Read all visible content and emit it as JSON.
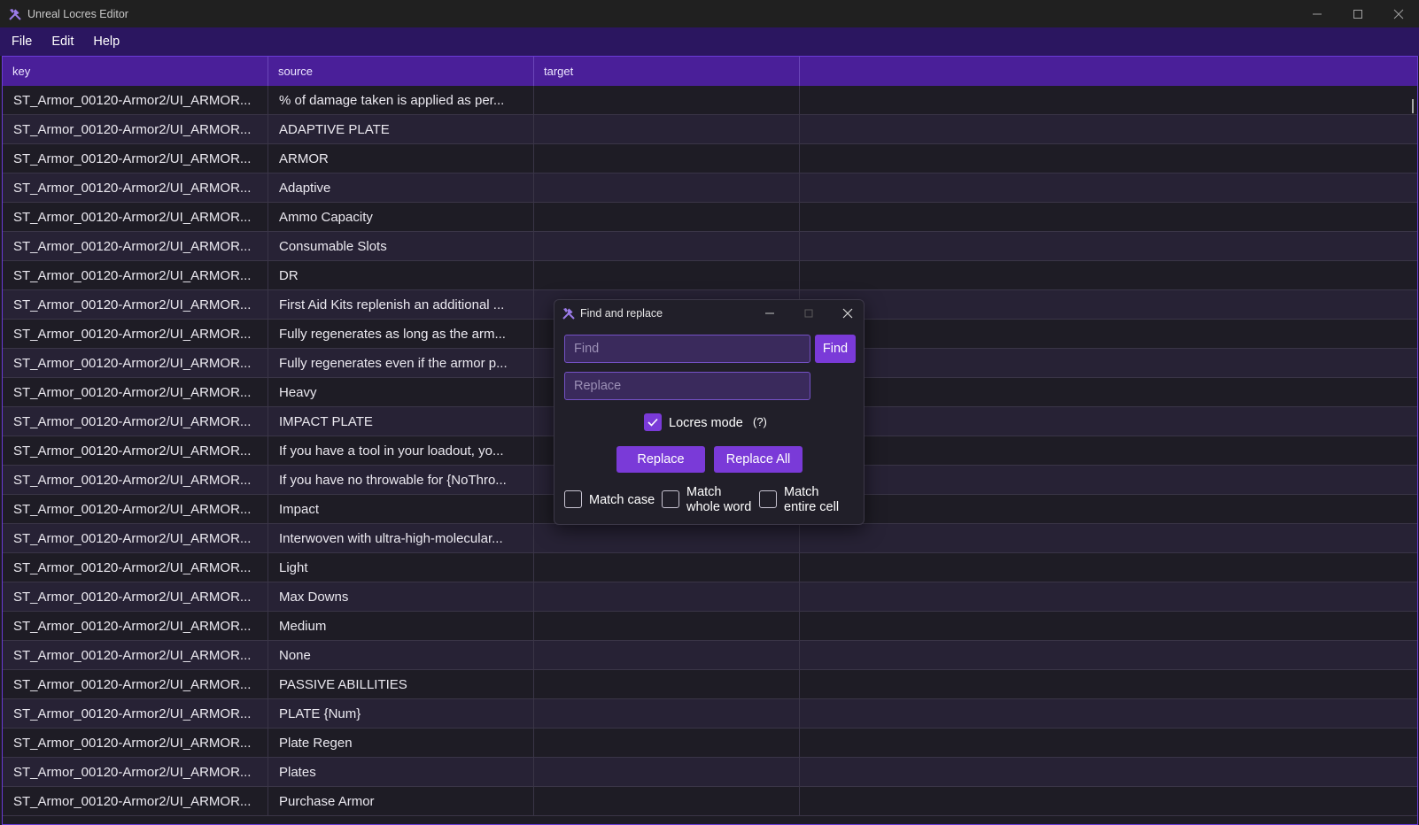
{
  "window": {
    "title": "Unreal Locres Editor"
  },
  "menu": {
    "file": "File",
    "edit": "Edit",
    "help": "Help"
  },
  "columns": [
    "key",
    "source",
    "target",
    ""
  ],
  "rows": [
    {
      "key": "ST_Armor_00120-Armor2/UI_ARMOR...",
      "source": "% of damage taken is applied as per..."
    },
    {
      "key": "ST_Armor_00120-Armor2/UI_ARMOR...",
      "source": "ADAPTIVE PLATE"
    },
    {
      "key": "ST_Armor_00120-Armor2/UI_ARMOR...",
      "source": "ARMOR"
    },
    {
      "key": "ST_Armor_00120-Armor2/UI_ARMOR...",
      "source": "Adaptive"
    },
    {
      "key": "ST_Armor_00120-Armor2/UI_ARMOR...",
      "source": "Ammo Capacity"
    },
    {
      "key": "ST_Armor_00120-Armor2/UI_ARMOR...",
      "source": "Consumable Slots"
    },
    {
      "key": "ST_Armor_00120-Armor2/UI_ARMOR...",
      "source": "DR"
    },
    {
      "key": "ST_Armor_00120-Armor2/UI_ARMOR...",
      "source": "First Aid Kits replenish an additional ..."
    },
    {
      "key": "ST_Armor_00120-Armor2/UI_ARMOR...",
      "source": "Fully regenerates as long as the arm..."
    },
    {
      "key": "ST_Armor_00120-Armor2/UI_ARMOR...",
      "source": "Fully regenerates even if the armor p..."
    },
    {
      "key": "ST_Armor_00120-Armor2/UI_ARMOR...",
      "source": "Heavy"
    },
    {
      "key": "ST_Armor_00120-Armor2/UI_ARMOR...",
      "source": "IMPACT PLATE"
    },
    {
      "key": "ST_Armor_00120-Armor2/UI_ARMOR...",
      "source": "If you have a tool in your loadout, yo..."
    },
    {
      "key": "ST_Armor_00120-Armor2/UI_ARMOR...",
      "source": "If you have no throwable for {NoThro..."
    },
    {
      "key": "ST_Armor_00120-Armor2/UI_ARMOR...",
      "source": "Impact"
    },
    {
      "key": "ST_Armor_00120-Armor2/UI_ARMOR...",
      "source": "Interwoven with ultra-high-molecular..."
    },
    {
      "key": "ST_Armor_00120-Armor2/UI_ARMOR...",
      "source": "Light"
    },
    {
      "key": "ST_Armor_00120-Armor2/UI_ARMOR...",
      "source": "Max Downs"
    },
    {
      "key": "ST_Armor_00120-Armor2/UI_ARMOR...",
      "source": "Medium"
    },
    {
      "key": "ST_Armor_00120-Armor2/UI_ARMOR...",
      "source": "None"
    },
    {
      "key": "ST_Armor_00120-Armor2/UI_ARMOR...",
      "source": "PASSIVE ABILLITIES"
    },
    {
      "key": "ST_Armor_00120-Armor2/UI_ARMOR...",
      "source": "PLATE {Num}"
    },
    {
      "key": "ST_Armor_00120-Armor2/UI_ARMOR...",
      "source": "Plate Regen"
    },
    {
      "key": "ST_Armor_00120-Armor2/UI_ARMOR...",
      "source": "Plates"
    },
    {
      "key": "ST_Armor_00120-Armor2/UI_ARMOR...",
      "source": "Purchase Armor"
    }
  ],
  "dialog": {
    "title": "Find and replace",
    "find_placeholder": "Find",
    "find_value": "",
    "find_button": "Find",
    "replace_placeholder": "Replace",
    "replace_value": "",
    "locres_mode_label": "Locres mode",
    "locres_mode_help": "(?)",
    "locres_mode_checked": true,
    "replace_button": "Replace",
    "replace_all_button": "Replace All",
    "match_case_label": "Match case",
    "match_whole_word_label_1": "Match",
    "match_whole_word_label_2": "whole word",
    "match_entire_cell_label_1": "Match",
    "match_entire_cell_label_2": "entire cell"
  },
  "colors": {
    "accent": "#7a3ad8",
    "header": "#4a1f99",
    "menubar": "#2b1660"
  }
}
